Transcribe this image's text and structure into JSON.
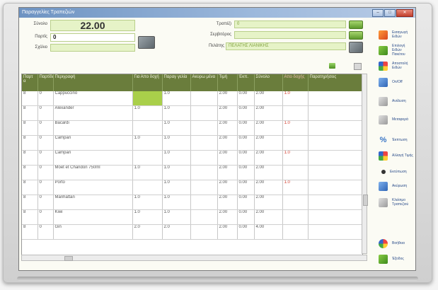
{
  "window": {
    "title": "Παραγγελίες Τραπεζιών"
  },
  "header": {
    "total_label": "Σύνολο",
    "total_value": "22.00",
    "order_label": "Παρτίς",
    "order_value": "0",
    "extra_label": "Σχόλιο",
    "extra_value": "",
    "table_label": "Τραπέζι",
    "table_value": "0",
    "waiter_label": "Σερβιτόρος",
    "waiter_value": "",
    "customer_label": "Πελάτης",
    "customer_value": "ΠΕΛΑΤΗΣ ΛΙΑΝΙΚΗΣ"
  },
  "grid": {
    "columns": [
      "Παρτ α",
      "Παρτίδα",
      "Περιγραφή",
      "Για Απο δοχή",
      "Παραγ γελία",
      "Ακυρω μένα",
      "Τιμή",
      "Έκπ.",
      "Σύνολο",
      "Απο δοχής",
      "Παρατηρήσεις"
    ],
    "rows": [
      [
        "8",
        "0",
        "Cappuccino",
        "",
        "1.0",
        "",
        "2.00",
        "0.00",
        "2.00",
        "1.0",
        ""
      ],
      [
        "8",
        "0",
        "Alexander",
        "1.0",
        "1.0",
        "",
        "2.00",
        "0.00",
        "2.00",
        "",
        ""
      ],
      [
        "8",
        "0",
        "Bacardi",
        "",
        "1.0",
        "",
        "2.00",
        "0.00",
        "2.00",
        "1.0",
        ""
      ],
      [
        "8",
        "0",
        "Campari",
        "1.0",
        "1.0",
        "",
        "2.00",
        "0.00",
        "2.00",
        "",
        ""
      ],
      [
        "8",
        "0",
        "Campari",
        "",
        "1.0",
        "",
        "2.00",
        "0.00",
        "2.00",
        "1.0",
        ""
      ],
      [
        "8",
        "0",
        "Moet et Chandon 750ml",
        "1.0",
        "1.0",
        "",
        "2.00",
        "0.00",
        "2.00",
        "",
        ""
      ],
      [
        "8",
        "0",
        "Porto",
        "",
        "1.0",
        "",
        "2.00",
        "0.00",
        "2.00",
        "1.0",
        ""
      ],
      [
        "8",
        "0",
        "Manhattan",
        "1.0",
        "1.0",
        "",
        "2.00",
        "0.00",
        "2.00",
        "",
        ""
      ],
      [
        "8",
        "0",
        "Kiwi",
        "1.0",
        "1.0",
        "",
        "2.00",
        "0.00",
        "2.00",
        "",
        ""
      ],
      [
        "8",
        "0",
        "Gin",
        "2.0",
        "2.0",
        "",
        "2.00",
        "0.00",
        "4.00",
        "",
        ""
      ]
    ]
  },
  "toolbar": {
    "items": [
      {
        "label": "Εισαγωγή Ειδών",
        "icon": "add-items-icon"
      },
      {
        "label": "Επιλογή Ειδών Πακέτου",
        "icon": "checklist-icon"
      },
      {
        "label": "Αποστολή Ειδών",
        "icon": "send-items-icon"
      },
      {
        "label": "On/Off",
        "icon": "on-off-icon"
      },
      {
        "label": "Ανάλυση",
        "icon": "split-icon"
      },
      {
        "label": "Μεταφορά",
        "icon": "transfer-icon"
      },
      {
        "label": "Έκπτωση",
        "icon": "percent-icon"
      },
      {
        "label": "Αλλαγή Τιμής",
        "icon": "change-price-icon"
      },
      {
        "label": "Εκτύπωση",
        "icon": "print-dot-icon"
      },
      {
        "label": "Ακύρωση",
        "icon": "cancel-order-icon"
      },
      {
        "label": "Κλείσιμο Τραπεζιού",
        "icon": "close-table-icon"
      },
      {
        "label": "Βοήθεια",
        "icon": "help-icon"
      },
      {
        "label": "Έξοδος",
        "icon": "exit-icon"
      }
    ]
  },
  "colors": {
    "header_bg": "#6a7d3c",
    "field_bg": "#e6f3c7",
    "highlight": "#a9cf4a",
    "accent_text": "#d23a2a"
  }
}
